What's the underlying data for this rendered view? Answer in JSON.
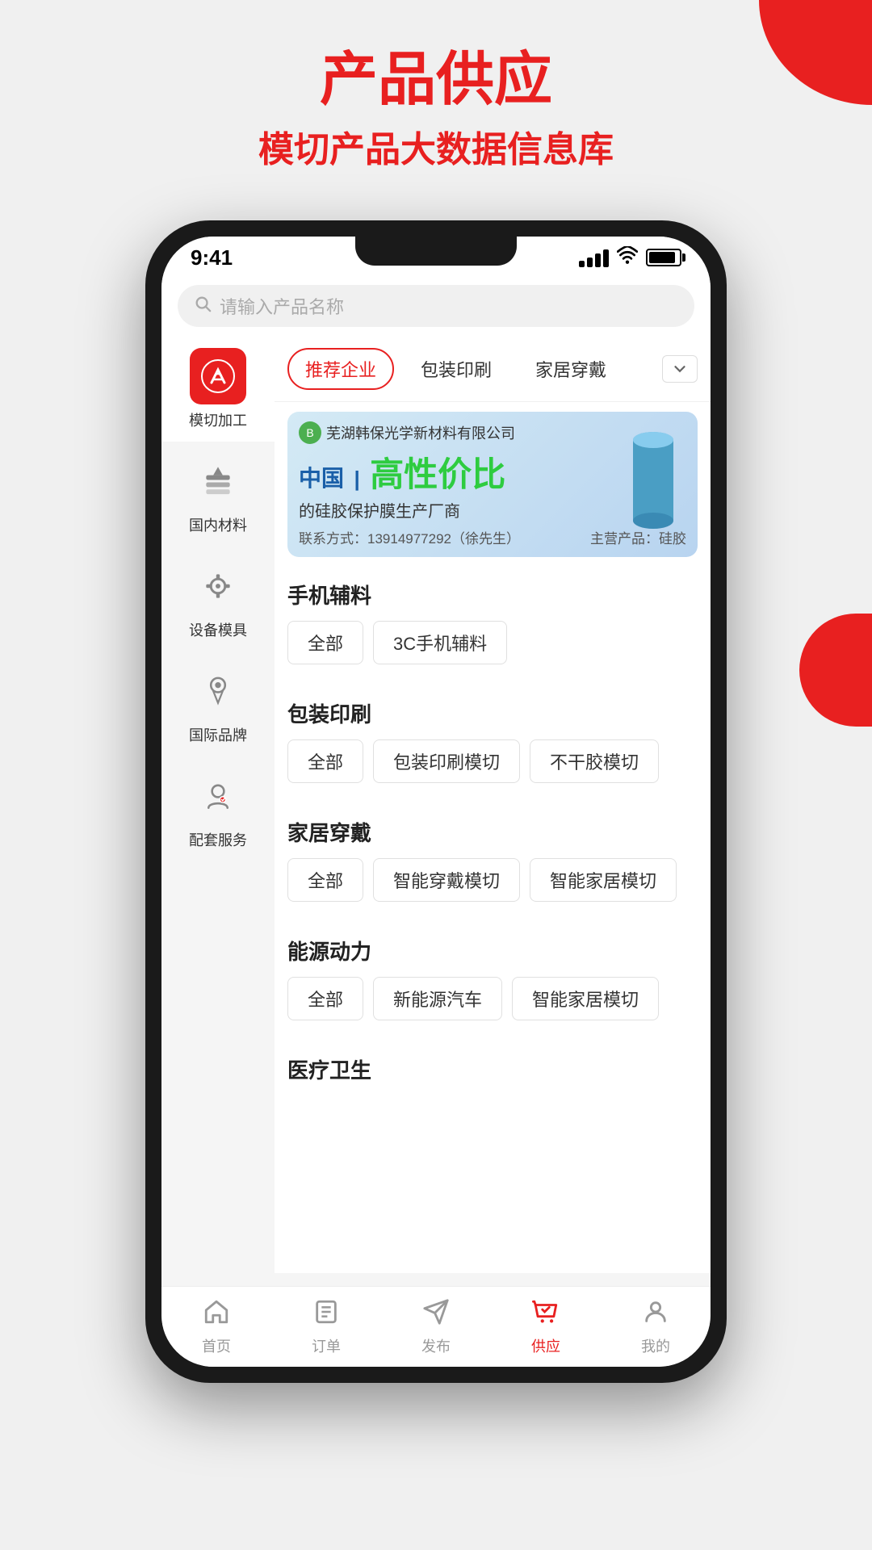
{
  "page": {
    "background_color": "#f0f0f0",
    "header": {
      "title": "产品供应",
      "subtitle": "模切产品大数据信息库"
    },
    "status_bar": {
      "time": "9:41",
      "signal": "signal",
      "wifi": "wifi",
      "battery": "battery"
    },
    "search": {
      "placeholder": "请输入产品名称"
    },
    "filter_tabs": [
      {
        "label": "推荐企业",
        "active": true
      },
      {
        "label": "包装印刷",
        "active": false
      },
      {
        "label": "家居穿戴",
        "active": false
      }
    ],
    "sidebar": {
      "items": [
        {
          "label": "模切加工",
          "active": true,
          "icon": "tool-red"
        },
        {
          "label": "国内材料",
          "active": false,
          "icon": "material"
        },
        {
          "label": "设备模具",
          "active": false,
          "icon": "gear"
        },
        {
          "label": "国际品牌",
          "active": false,
          "icon": "brand"
        },
        {
          "label": "配套服务",
          "active": false,
          "icon": "service"
        }
      ]
    },
    "banner": {
      "company": "芜湖韩保光学新材料有限公司",
      "china_label": "中国",
      "highlight": "高性价比",
      "sub_text": "的硅胶保护膜生产厂商",
      "contact": "联系方式：13914977292（徐先生）",
      "main_product": "主营产品：硅胶"
    },
    "categories": [
      {
        "title": "手机辅料",
        "tags": [
          "全部",
          "3C手机辅料"
        ]
      },
      {
        "title": "包装印刷",
        "tags": [
          "全部",
          "包装印刷模切",
          "不干胶模切"
        ]
      },
      {
        "title": "家居穿戴",
        "tags": [
          "全部",
          "智能穿戴模切",
          "智能家居模切"
        ]
      },
      {
        "title": "能源动力",
        "tags": [
          "全部",
          "新能源汽车",
          "智能家居模切"
        ]
      },
      {
        "title": "医疗卫生",
        "tags": []
      }
    ],
    "bottom_nav": [
      {
        "label": "首页",
        "active": false,
        "icon": "home"
      },
      {
        "label": "订单",
        "active": false,
        "icon": "order"
      },
      {
        "label": "发布",
        "active": false,
        "icon": "publish"
      },
      {
        "label": "供应",
        "active": true,
        "icon": "supply"
      },
      {
        "label": "我的",
        "active": false,
        "icon": "profile"
      }
    ]
  }
}
